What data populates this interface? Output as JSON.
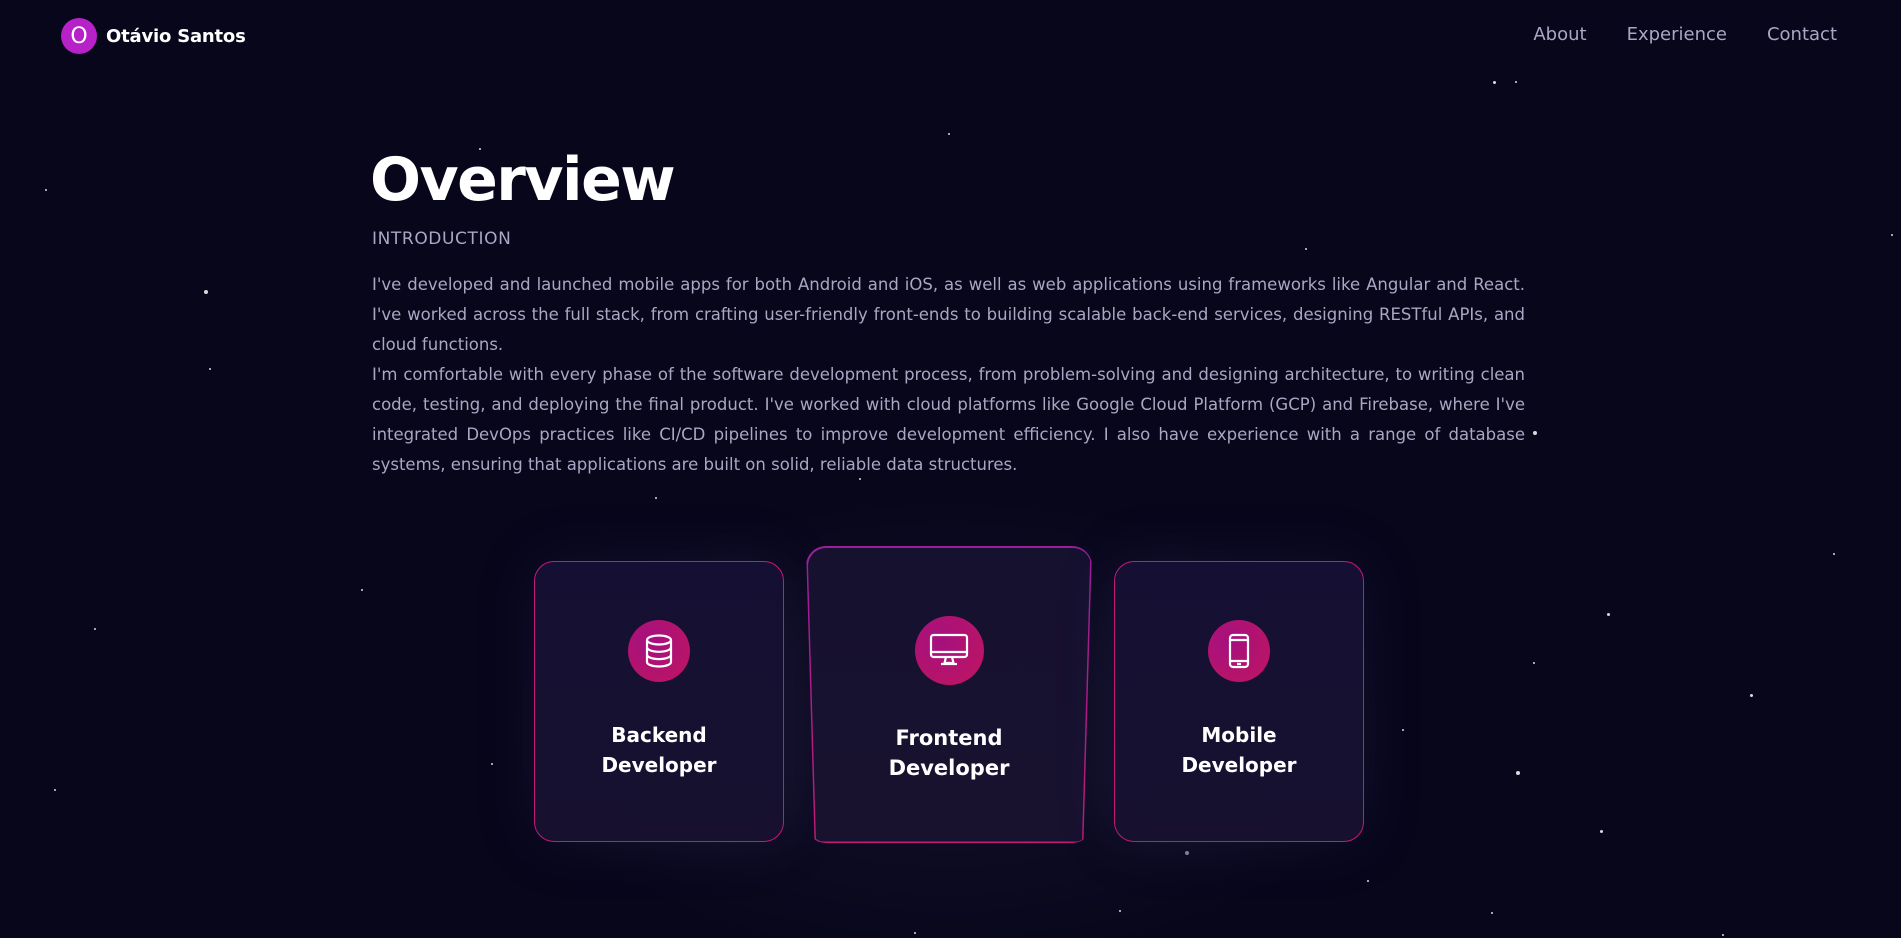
{
  "nav": {
    "logo_letter": "O",
    "brand_name": "Otávio Santos",
    "links": [
      "About",
      "Experience",
      "Contact"
    ]
  },
  "overview": {
    "title": "Overview",
    "subtitle": "INTRODUCTION",
    "paragraphs": [
      "I've developed and launched mobile apps for both Android and iOS, as well as web applications using frameworks like Angular and React. I've worked across the full stack, from crafting user-friendly front-ends to building scalable back-end services, designing RESTful APIs, and cloud functions.",
      "I'm comfortable with every phase of the software development process, from problem-solving and designing architecture, to writing clean code, testing, and deploying the final product. I've worked with cloud platforms like Google Cloud Platform (GCP) and Firebase, where I've integrated DevOps practices like CI/CD pipelines to improve development efficiency. I also have experience with a range of database systems, ensuring that applications are built on solid, reliable data structures."
    ]
  },
  "services": [
    {
      "title_line1": "Backend",
      "title_line2": "Developer",
      "icon": "database-icon"
    },
    {
      "title_line1": "Frontend",
      "title_line2": "Developer",
      "icon": "monitor-icon"
    },
    {
      "title_line1": "Mobile",
      "title_line2": "Developer",
      "icon": "smartphone-icon"
    }
  ],
  "colors": {
    "background": "#07061a",
    "accent": "#b622c8",
    "card_border": "#c21a76",
    "secondary_text": "#aaa6c3"
  }
}
